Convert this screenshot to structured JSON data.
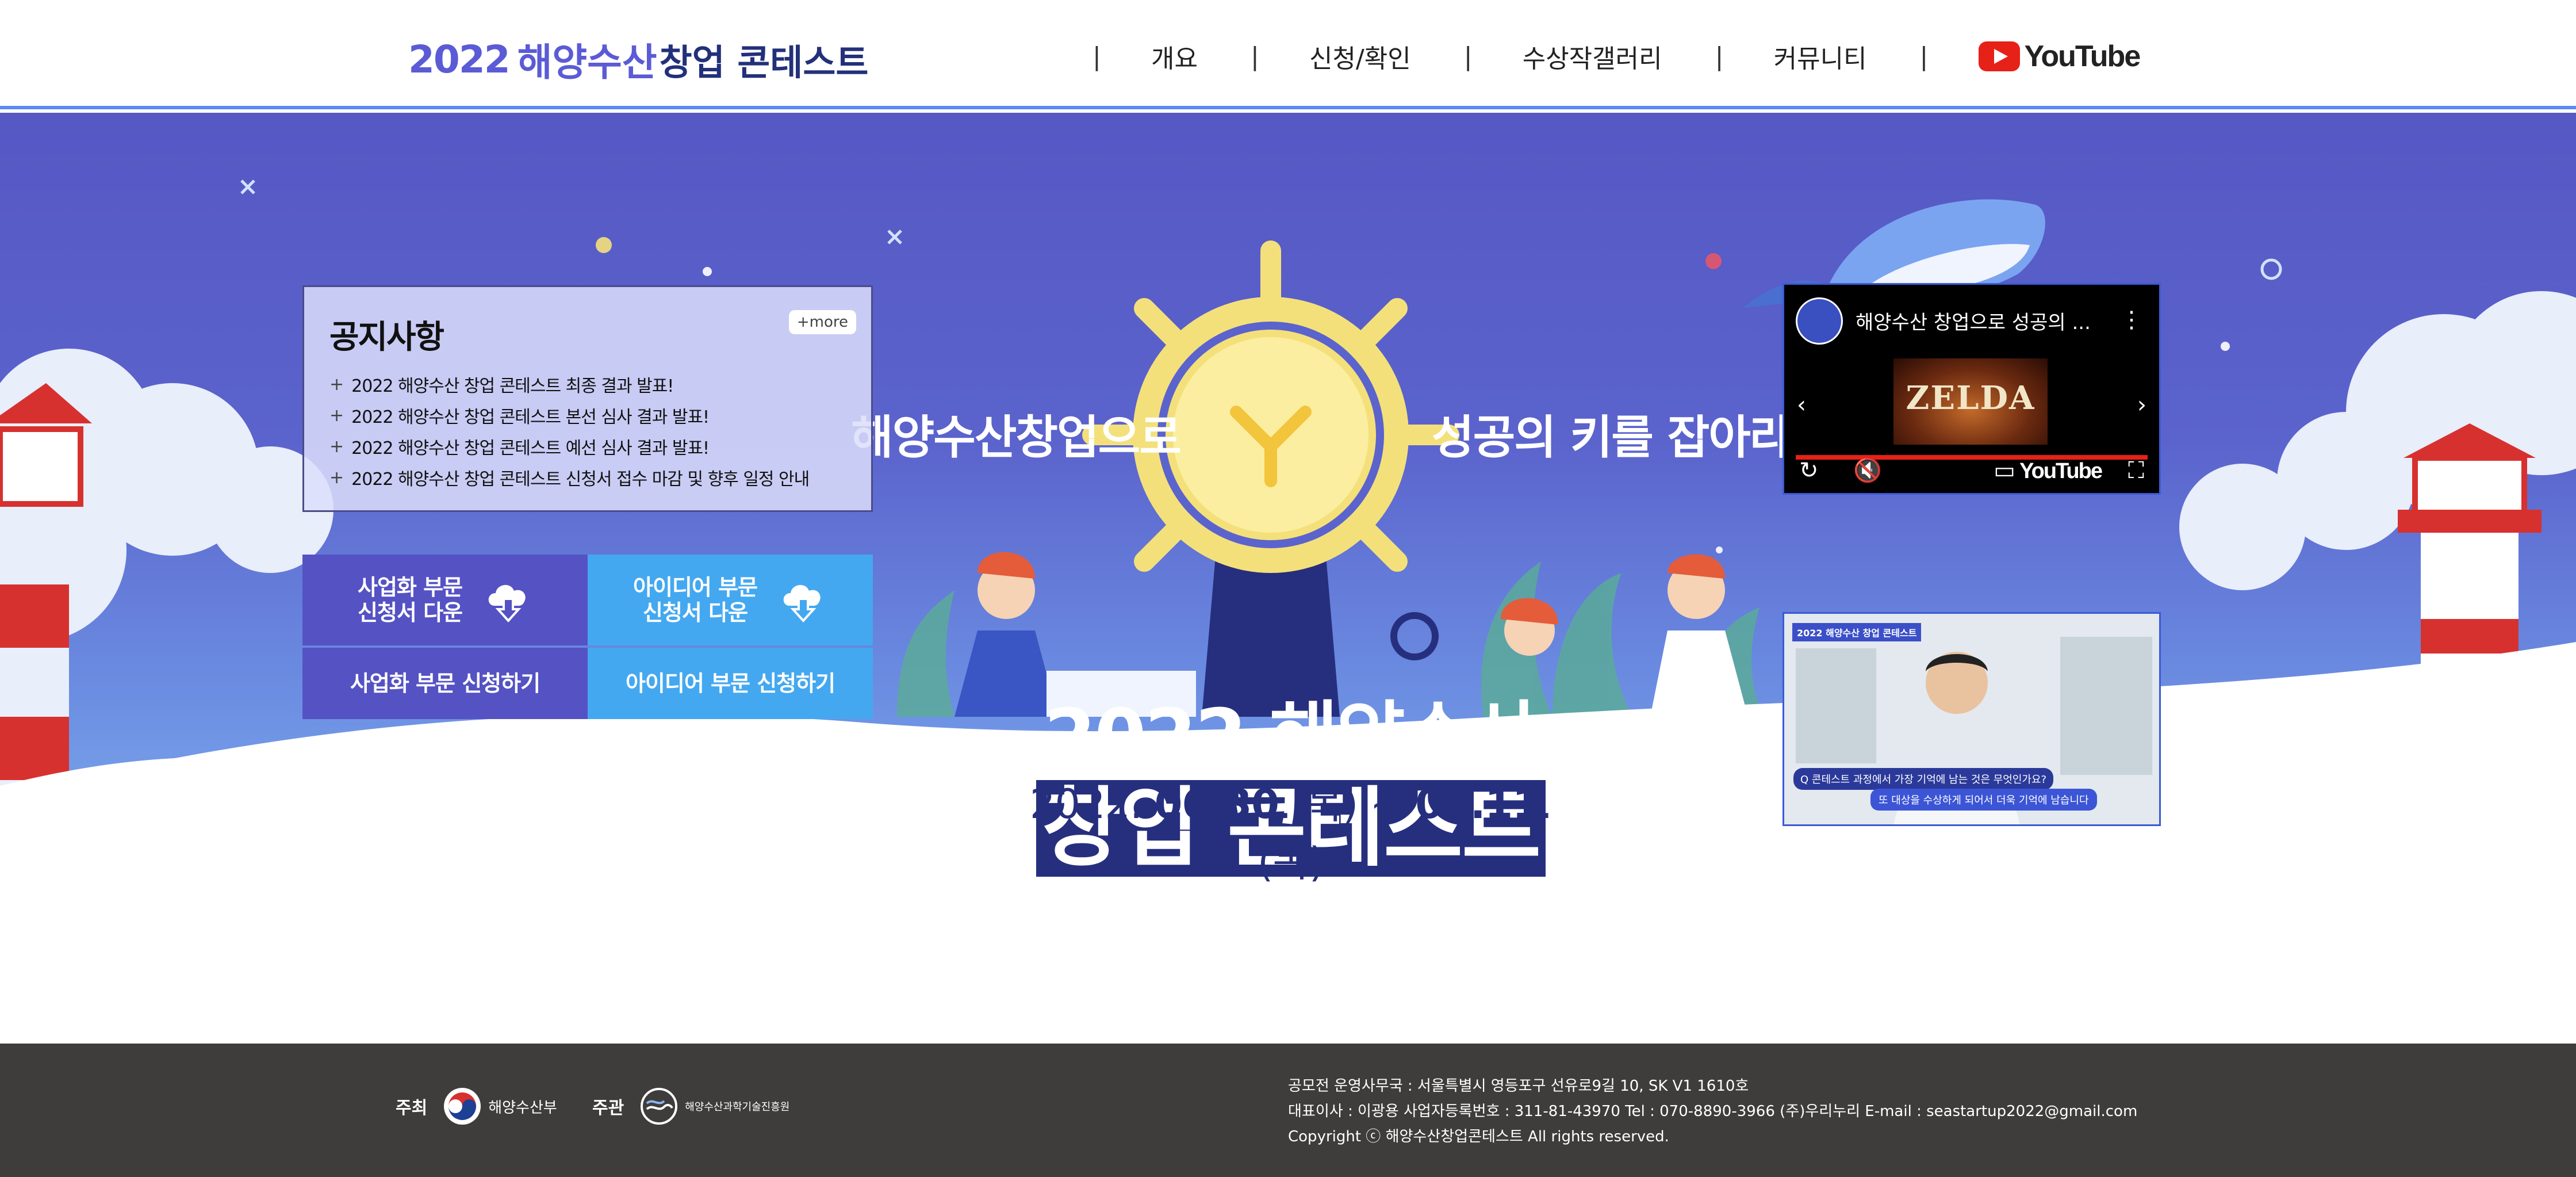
{
  "header": {
    "logo": {
      "year": "2022",
      "part1": "해양수산",
      "part2": "창업 콘테스트"
    },
    "nav": [
      "개요",
      "신청/확인",
      "수상작갤러리",
      "커뮤니티"
    ],
    "separator": "|",
    "youtube_label": "YouTube"
  },
  "hero": {
    "slogan_left": "해양수산창업으로",
    "slogan_right": "성공의 키를 잡아라",
    "notice": {
      "title": "공지사항",
      "more": "+more",
      "items": [
        "2022 해양수산 창업 콘테스트 최종 결과 발표!",
        "2022 해양수산 창업 콘테스트 본선 심사 결과 발표!",
        "2022 해양수산 창업 콘테스트 예선 심사 결과 발표!",
        "2022 해양수산 창업 콘테스트 신청서 접수 마감 및 향후 일정 안내"
      ]
    },
    "buttons": {
      "biz_download": [
        "사업화 부문",
        "신청서 다운"
      ],
      "idea_download": [
        "아이디어 부문",
        "신청서 다운"
      ],
      "biz_apply": "사업화 부문 신청하기",
      "idea_apply": "아이디어 부문 신청하기"
    },
    "video1": {
      "title": "해양수산 창업으로 성공의 ...",
      "thumb_text": "ZELDA",
      "youtube_label": "YouTube"
    },
    "video2": {
      "badge": "2022 해양수산 창업 콘테스트",
      "caption_q": "Q 콘테스트 과정에서 가장 기억에 남는 것은 무엇인가요?",
      "caption_a": "또 대상을 수상하게 되어서 더욱 기억에 남습니다"
    },
    "contest_title": {
      "line1": "2022 해양수산",
      "line2": "창업 콘테스트"
    },
    "date": {
      "year": "2022.",
      "start": "06.30",
      "start_day": ".(목)",
      "tilde": " ~ ",
      "end": "08.11",
      "end_day": ".(목)"
    }
  },
  "footer": {
    "host_role": "주최",
    "host_name": "해양수산부",
    "organizer_role": "주관",
    "organizer_name": "해양수산과학기술진흥원",
    "lines": [
      "공모전 운영사무국 : 서울특별시 영등포구 선유로9길 10, SK V1 1610호",
      "대표이사 : 이광용  사업자등록번호 : 311-81-43970  Tel : 070-8890-3966  (주)우리누리  E-mail : seastartup2022@gmail.com",
      "Copyright ⓒ 해양수산창업콘테스트 All rights reserved."
    ]
  },
  "colors": {
    "hero_purple": "#5658c4",
    "navy": "#262f7e",
    "btn_purple": "#5552c4",
    "btn_sky": "#44a8f0",
    "footer_bg": "#3f3c3c"
  }
}
